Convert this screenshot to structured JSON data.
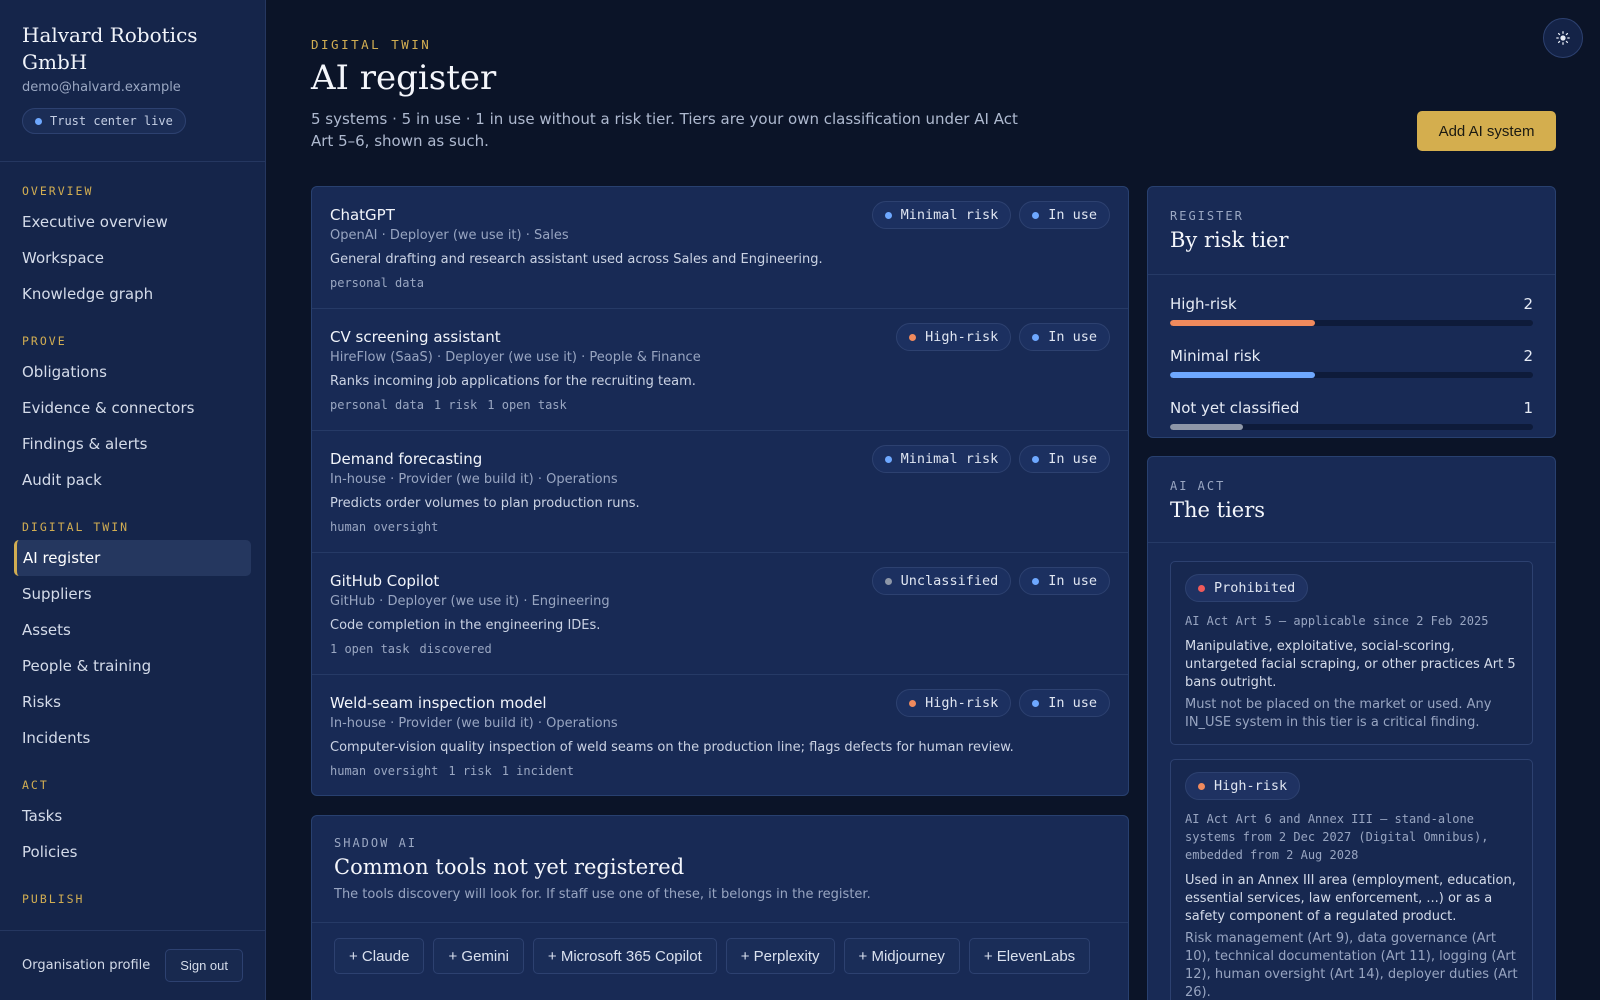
{
  "org": {
    "name": "Halvard Robotics GmbH",
    "email": "demo@halvard.example",
    "status_pill": "Trust center live"
  },
  "nav": {
    "sections": [
      {
        "label": "OVERVIEW",
        "items": [
          "Executive overview",
          "Workspace",
          "Knowledge graph"
        ]
      },
      {
        "label": "PROVE",
        "items": [
          "Obligations",
          "Evidence & connectors",
          "Findings & alerts",
          "Audit pack"
        ]
      },
      {
        "label": "DIGITAL TWIN",
        "items": [
          "AI register",
          "Suppliers",
          "Assets",
          "People & training",
          "Risks",
          "Incidents"
        ]
      },
      {
        "label": "ACT",
        "items": [
          "Tasks",
          "Policies"
        ]
      },
      {
        "label": "PUBLISH",
        "items": []
      }
    ],
    "active_item": "AI register"
  },
  "footer": {
    "org_profile": "Organisation profile",
    "sign_out": "Sign out"
  },
  "header": {
    "eyebrow": "DIGITAL TWIN",
    "title": "AI register",
    "subtitle": "5 systems · 5 in use · 1 in use without a risk tier. Tiers are your own classification under AI Act Art 5–6, shown as such.",
    "add_button": "Add AI system",
    "theme_icon": "sun-icon"
  },
  "systems": [
    {
      "name": "ChatGPT",
      "meta": "OpenAI · Deployer (we use it) · Sales",
      "description": "General drafting and research assistant used across Sales and Engineering.",
      "tags": [
        "personal data"
      ],
      "tier": "Minimal risk",
      "tier_color": "#6ea8ff",
      "status": "In use",
      "status_color": "#6ea8ff"
    },
    {
      "name": "CV screening assistant",
      "meta": "HireFlow (SaaS) · Deployer (we use it) · People & Finance",
      "description": "Ranks incoming job applications for the recruiting team.",
      "tags": [
        "personal data",
        "1 risk",
        "1 open task"
      ],
      "tier": "High-risk",
      "tier_color": "#f08a5d",
      "status": "In use",
      "status_color": "#6ea8ff"
    },
    {
      "name": "Demand forecasting",
      "meta": "In-house · Provider (we build it) · Operations",
      "description": "Predicts order volumes to plan production runs.",
      "tags": [
        "human oversight"
      ],
      "tier": "Minimal risk",
      "tier_color": "#6ea8ff",
      "status": "In use",
      "status_color": "#6ea8ff"
    },
    {
      "name": "GitHub Copilot",
      "meta": "GitHub · Deployer (we use it) · Engineering",
      "description": "Code completion in the engineering IDEs.",
      "tags": [
        "1 open task",
        "discovered"
      ],
      "tier": "Unclassified",
      "tier_color": "#8e97a8",
      "status": "In use",
      "status_color": "#6ea8ff"
    },
    {
      "name": "Weld-seam inspection model",
      "meta": "In-house · Provider (we build it) · Operations",
      "description": "Computer-vision quality inspection of weld seams on the production line; flags defects for human review.",
      "tags": [
        "human oversight",
        "1 risk",
        "1 incident"
      ],
      "tier": "High-risk",
      "tier_color": "#f08a5d",
      "status": "In use",
      "status_color": "#6ea8ff"
    }
  ],
  "shadow_ai": {
    "eyebrow": "SHADOW AI",
    "title": "Common tools not yet registered",
    "subtitle": "The tools discovery will look for. If staff use one of these, it belongs in the register.",
    "tools": [
      "+ Claude",
      "+ Gemini",
      "+ Microsoft 365 Copilot",
      "+ Perplexity",
      "+ Midjourney",
      "+ ElevenLabs"
    ]
  },
  "by_risk_tier": {
    "eyebrow": "REGISTER",
    "title": "By risk tier",
    "total": 5,
    "tiers": [
      {
        "label": "High-risk",
        "count": 2,
        "color": "#f08a5d"
      },
      {
        "label": "Minimal risk",
        "count": 2,
        "color": "#6ea8ff"
      },
      {
        "label": "Not yet classified",
        "count": 1,
        "color": "#8e97a8"
      }
    ]
  },
  "ai_act": {
    "eyebrow": "AI ACT",
    "title": "The tiers",
    "tiers": [
      {
        "badge": "Prohibited",
        "color": "#f05a5a",
        "reference": "AI Act Art 5 — applicable since 2 Feb 2025",
        "description": "Manipulative, exploitative, social-scoring, untargeted facial scraping, or other practices Art 5 bans outright.",
        "note": "Must not be placed on the market or used. Any IN_USE system in this tier is a critical finding."
      },
      {
        "badge": "High-risk",
        "color": "#f08a5d",
        "reference": "AI Act Art 6 and Annex III — stand-alone systems from 2 Dec 2027 (Digital Omnibus), embedded from 2 Aug 2028",
        "description": "Used in an Annex III area (employment, education, essential services, law enforcement, ...) or as a safety component of a regulated product.",
        "note": "Risk management (Art 9), data governance (Art 10), technical documentation (Art 11), logging (Art 12), human oversight (Art 14), deployer duties (Art 26)."
      }
    ]
  }
}
